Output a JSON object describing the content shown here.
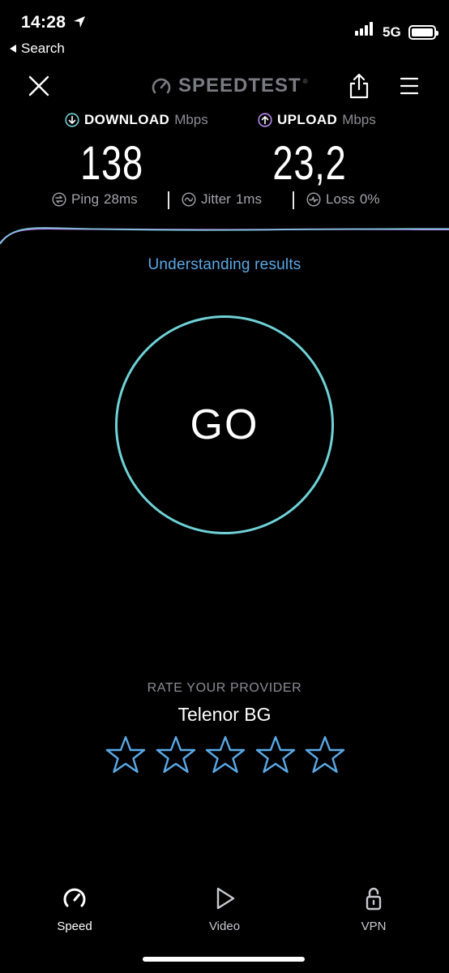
{
  "status_bar": {
    "time": "14:28",
    "back_label": "Search",
    "network": "5G"
  },
  "header": {
    "brand": "SPEEDTEST",
    "brand_tm": "®"
  },
  "results": {
    "download": {
      "label": "DOWNLOAD",
      "unit": "Mbps",
      "value": "138"
    },
    "upload": {
      "label": "UPLOAD",
      "unit": "Mbps",
      "value": "23,2"
    },
    "ping": {
      "label": "Ping",
      "value": "28ms"
    },
    "jitter": {
      "label": "Jitter",
      "value": "1ms"
    },
    "loss": {
      "label": "Loss",
      "value": "0%"
    }
  },
  "understanding_link": "Understanding results",
  "go_button": {
    "label": "GO"
  },
  "rating": {
    "title": "RATE YOUR PROVIDER",
    "provider": "Telenor BG",
    "stars_total": 5,
    "stars_selected": 0
  },
  "tabs": [
    {
      "label": "Speed",
      "icon": "speedometer-icon",
      "active": true
    },
    {
      "label": "Video",
      "icon": "play-icon",
      "active": false
    },
    {
      "label": "VPN",
      "icon": "lock-icon",
      "active": false
    }
  ],
  "colors": {
    "accent_teal": "#6fd1d6",
    "download_teal": "#6fd1d6",
    "upload_purple": "#b78af0",
    "link_blue": "#5aa9e6",
    "star_blue": "#5aa9e6"
  }
}
